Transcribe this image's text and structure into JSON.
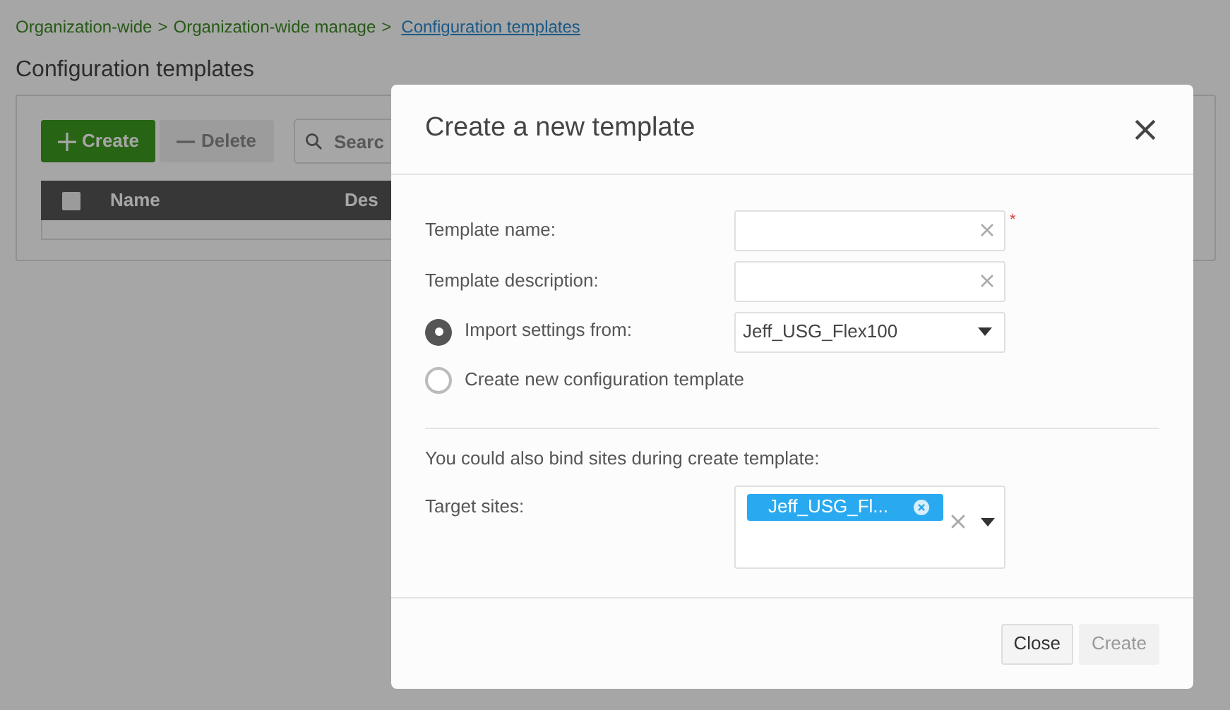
{
  "breadcrumb": {
    "separator": ">",
    "items": [
      {
        "label": "Organization-wide",
        "current": false
      },
      {
        "label": "Organization-wide manage",
        "current": false
      },
      {
        "label": "Configuration templates",
        "current": true
      }
    ]
  },
  "page_title": "Configuration templates",
  "toolbar": {
    "buttons": [
      {
        "label": "Create",
        "kind": "primary",
        "disabled": false
      },
      {
        "label": "Delete",
        "kind": "secondary",
        "disabled": true
      }
    ],
    "search": {
      "placeholder": "Searc"
    }
  },
  "table": {
    "select_all_checked": false,
    "columns": [
      "Name",
      "Des"
    ]
  },
  "dialog": {
    "title": "Create a new template",
    "fields": [
      {
        "label": "Template name:",
        "required_mark": "*"
      },
      {
        "label": "Template description:"
      }
    ],
    "options": [
      {
        "label": "Import settings from:",
        "selected": true,
        "select_value": "Jeff_USG_Flex100"
      },
      {
        "label": "Create new configuration template",
        "selected": false
      }
    ],
    "hint": "You could also bind sites during create template:",
    "target_sites": {
      "label": "Target sites:",
      "tags": [
        "Jeff_USG_Fl..."
      ]
    },
    "buttons": [
      {
        "label": "Close",
        "disabled": false
      },
      {
        "label": "Create",
        "disabled": true
      }
    ]
  }
}
